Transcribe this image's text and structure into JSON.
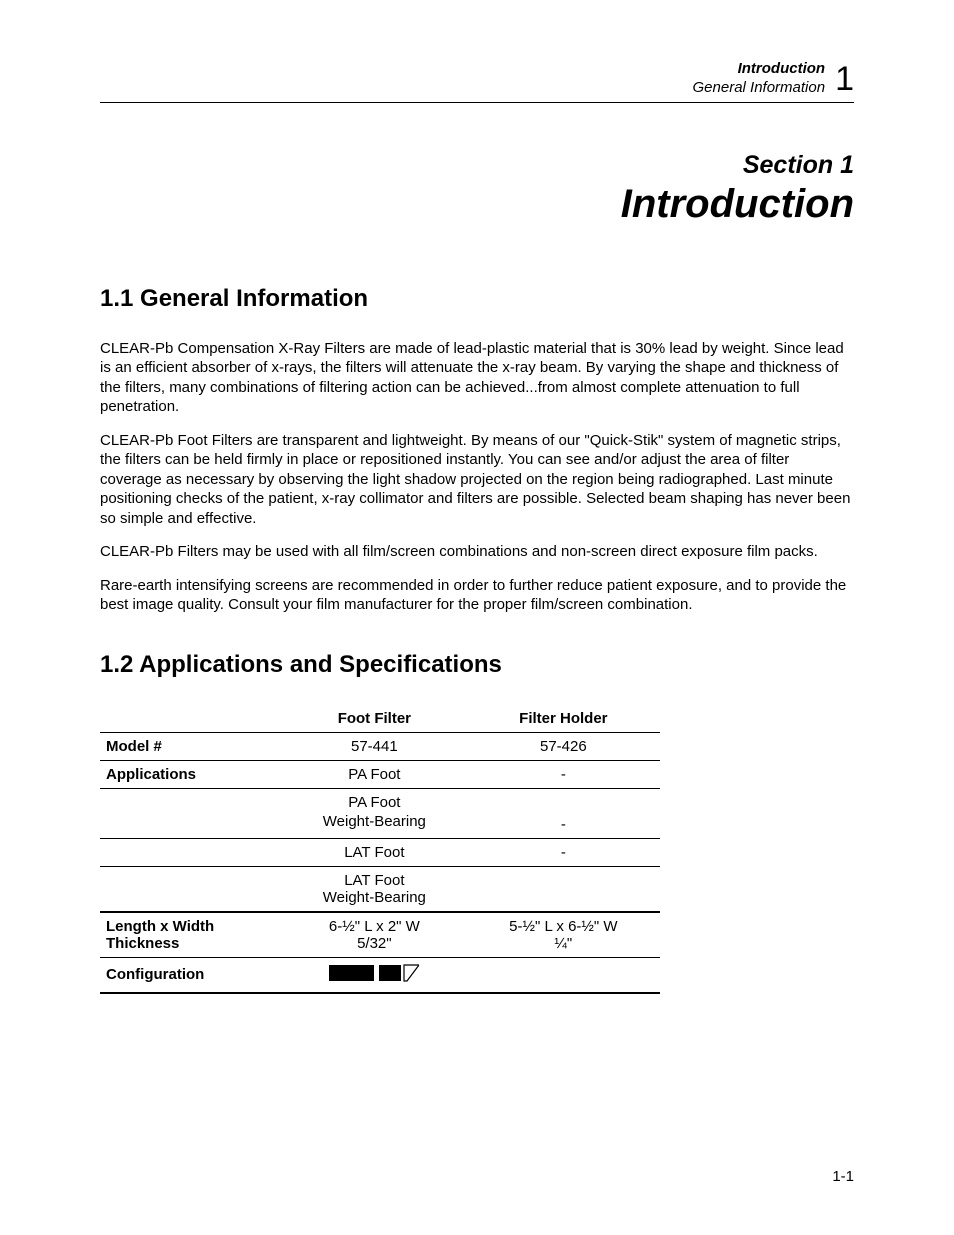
{
  "header": {
    "line1": "Introduction",
    "line2": "General Information",
    "chapter_number": "1"
  },
  "section": {
    "label": "Section 1",
    "title": "Introduction"
  },
  "h_general": "1.1 General Information",
  "para1": "CLEAR-Pb Compensation X-Ray Filters are made of lead-plastic material that is 30% lead by weight. Since lead is an efficient absorber of x-rays, the filters will attenuate the x-ray beam.  By varying the shape and thickness of the filters, many combinations of filtering action can be achieved...from almost complete attenuation to full penetration.",
  "para2": "CLEAR-Pb Foot Filters are transparent and lightweight.  By means of our \"Quick-Stik\" system of magnetic strips, the filters can be held firmly in place or repositioned instantly.  You can see and/or adjust the area of filter coverage as necessary by observing the light shadow projected on the region being radiographed.  Last minute positioning checks of the patient, x-ray collimator and filters are possible. Selected beam shaping has never been so simple and effective.",
  "para3": "CLEAR-Pb Filters may be used with all film/screen combinations and non-screen direct exposure film packs.",
  "para4": "Rare-earth intensifying screens are recommended in order to further reduce patient exposure, and to provide the best image quality. Consult your film manufacturer for the proper film/screen combination.",
  "h_apps": "1.2 Applications and Specifications",
  "table": {
    "col1": "Foot Filter",
    "col2": "Filter Holder",
    "rows": {
      "model": {
        "label": "Model #",
        "c1": "57-441",
        "c2": "57-426"
      },
      "app1": {
        "label": "Applications",
        "c1": "PA Foot",
        "c2": "-"
      },
      "app2a": {
        "c1": "PA Foot"
      },
      "app2b": {
        "c1": "Weight-Bearing",
        "c2": "-"
      },
      "app3": {
        "c1": "LAT Foot",
        "c2": "-"
      },
      "app4a": {
        "c1": "LAT Foot"
      },
      "app4b": {
        "c1": "Weight-Bearing"
      },
      "dim1": {
        "label": "Length x Width",
        "c1": "6-½\" L x 2\" W",
        "c2": "5-½\" L x 6-½\" W"
      },
      "dim2": {
        "label": "Thickness",
        "c1": "5/32\"",
        "c2": "¼\""
      },
      "config": {
        "label": "Configuration"
      }
    }
  },
  "footer": "1-1"
}
